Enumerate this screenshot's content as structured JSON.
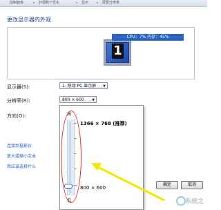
{
  "breadcrumb": [
    "控制面板",
    "外观和个性化",
    "显示",
    "屏幕分辨率"
  ],
  "page_title": "更改显示器的外观",
  "preview": {
    "overlay_text": "CPU：7%  内存：45%",
    "monitor_number": "1"
  },
  "form": {
    "display_label": "显示器(S):",
    "display_value": "1. 移动 PC 显示屏",
    "resolution_label": "分辨率(R):",
    "resolution_value": "800 × 600",
    "orientation_label": "方向(O):"
  },
  "dropdown": {
    "top_label": "高",
    "bottom_label": "低",
    "option_top": "1366 × 768 (推荐)",
    "option_bottom": "800 × 600"
  },
  "links": [
    "连接到投影仪",
    "放大或缩小文本",
    "我应该选择什么"
  ],
  "buttons": {
    "ok": "确定",
    "cancel": "取消"
  },
  "watermark": "系统之"
}
